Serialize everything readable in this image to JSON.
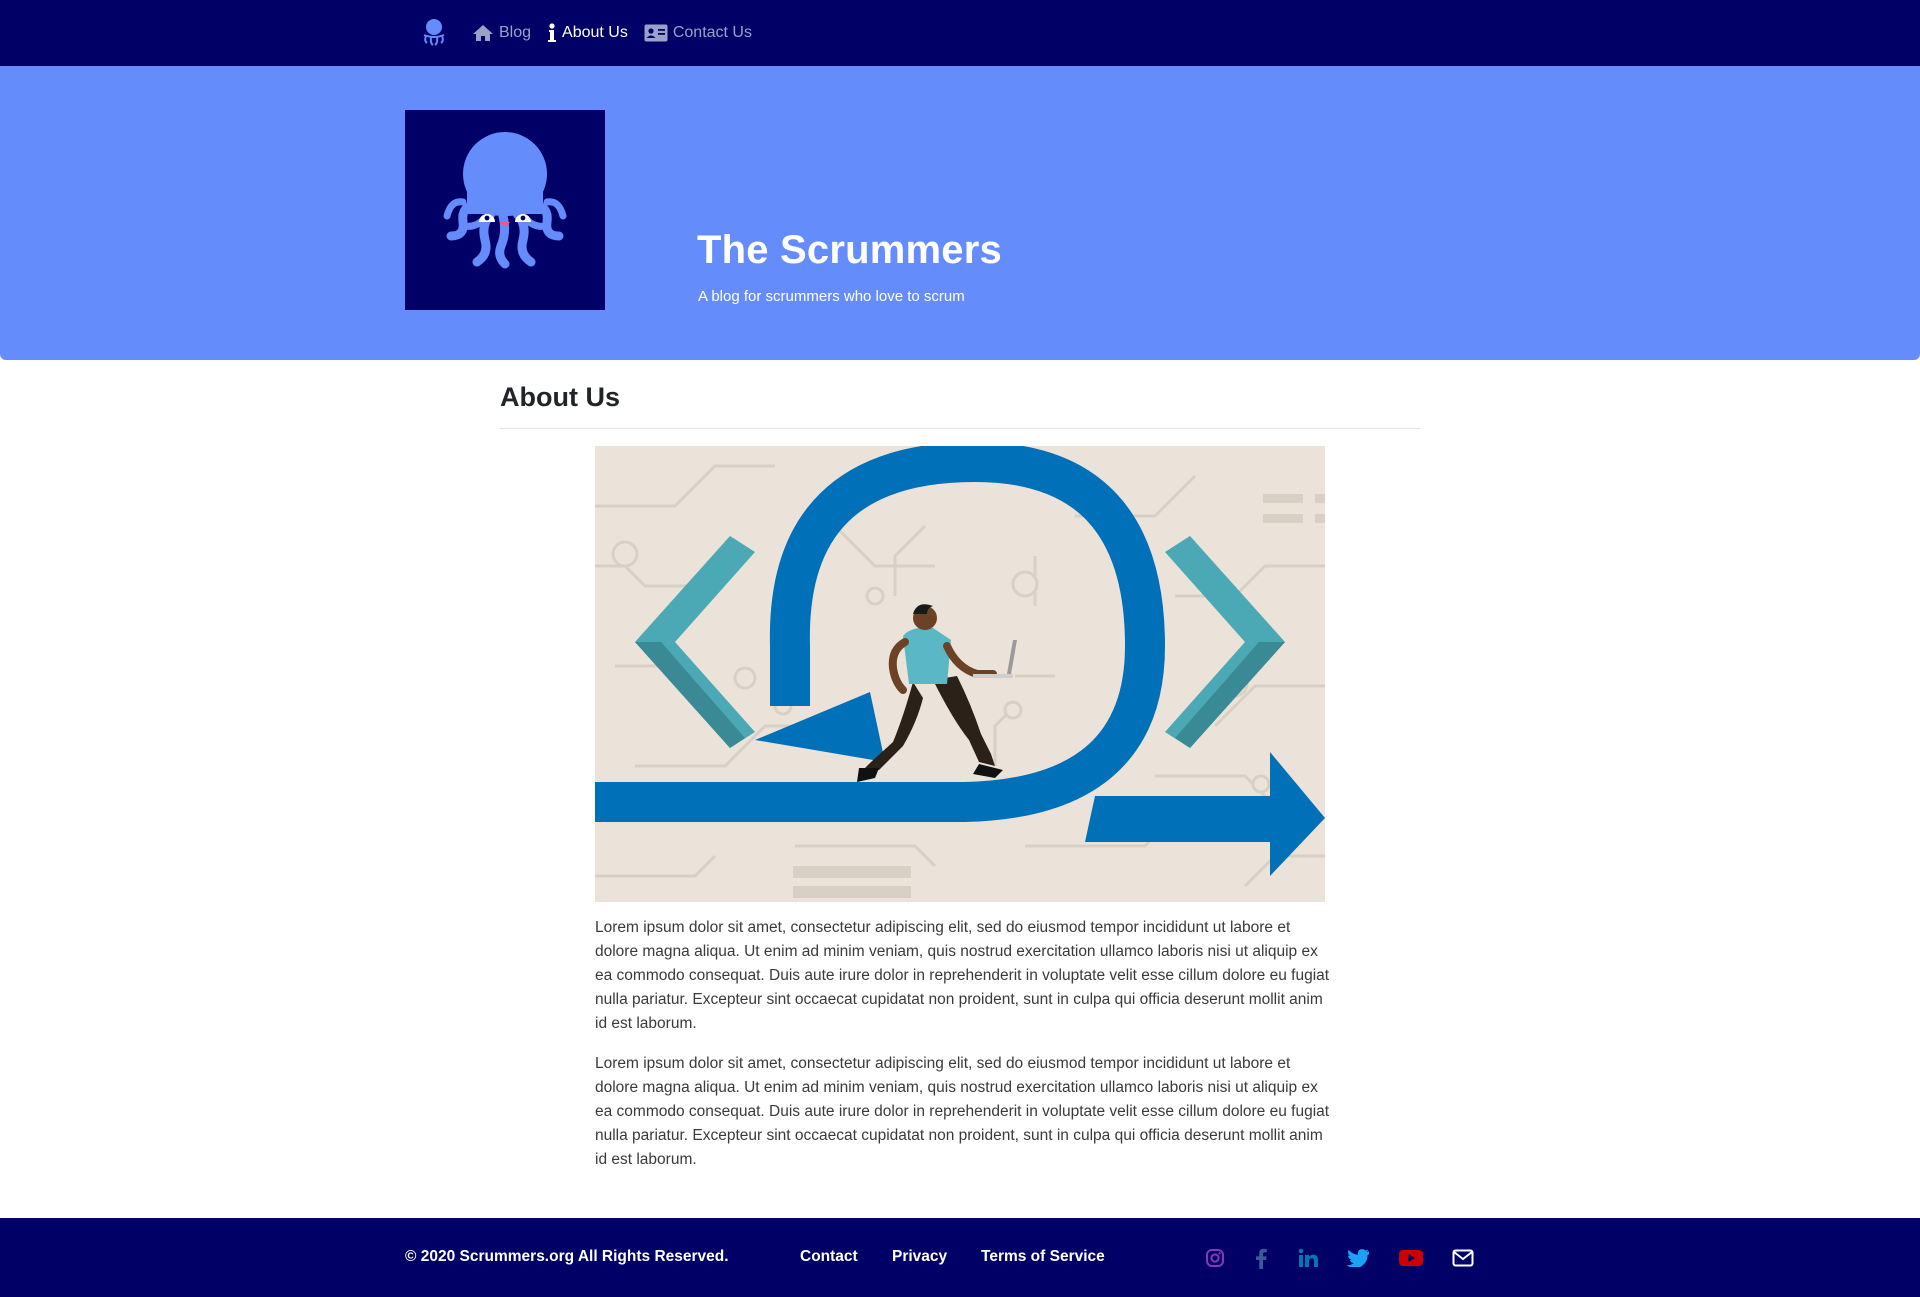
{
  "nav": {
    "brand_icon": "octopus-icon",
    "items": [
      {
        "label": "Blog",
        "icon": "home-icon",
        "active": false
      },
      {
        "label": "About Us",
        "icon": "info-icon",
        "active": true
      },
      {
        "label": "Contact Us",
        "icon": "id-card-icon",
        "active": false
      }
    ]
  },
  "hero": {
    "title": "The Scrummers",
    "subtitle": "A blog for scrummers who love to scrum",
    "logo_icon": "octopus-icon"
  },
  "main": {
    "title": "About Us",
    "image_icon": "scrum-runner-illustration",
    "paragraphs": [
      "Lorem ipsum dolor sit amet, consectetur adipiscing elit, sed do eiusmod tempor incididunt ut labore et dolore magna aliqua. Ut enim ad minim veniam, quis nostrud exercitation ullamco laboris nisi ut aliquip ex ea commodo consequat. Duis aute irure dolor in reprehenderit in voluptate velit esse cillum dolore eu fugiat nulla pariatur. Excepteur sint occaecat cupidatat non proident, sunt in culpa qui officia deserunt mollit anim id est laborum.",
      "Lorem ipsum dolor sit amet, consectetur adipiscing elit, sed do eiusmod tempor incididunt ut labore et dolore magna aliqua. Ut enim ad minim veniam, quis nostrud exercitation ullamco laboris nisi ut aliquip ex ea commodo consequat. Duis aute irure dolor in reprehenderit in voluptate velit esse cillum dolore eu fugiat nulla pariatur. Excepteur sint occaecat cupidatat non proident, sunt in culpa qui officia deserunt mollit anim id est laborum."
    ]
  },
  "footer": {
    "copyright": "© 2020 Scrummers.org All Rights Reserved.",
    "links": [
      "Contact",
      "Privacy",
      "Terms of Service"
    ],
    "social": [
      {
        "icon": "instagram-icon",
        "color": "#833ab4"
      },
      {
        "icon": "facebook-icon",
        "color": "#3b5998"
      },
      {
        "icon": "linkedin-icon",
        "color": "#0077b5"
      },
      {
        "icon": "twitter-icon",
        "color": "#1da1f2"
      },
      {
        "icon": "youtube-icon",
        "color": "#cc0000"
      },
      {
        "icon": "envelope-icon",
        "color": "#ffffff"
      }
    ]
  },
  "colors": {
    "navy": "#010066",
    "hero_blue": "#648cfb",
    "accent_blue": "#0070b8",
    "teal": "#4ba8b5"
  }
}
